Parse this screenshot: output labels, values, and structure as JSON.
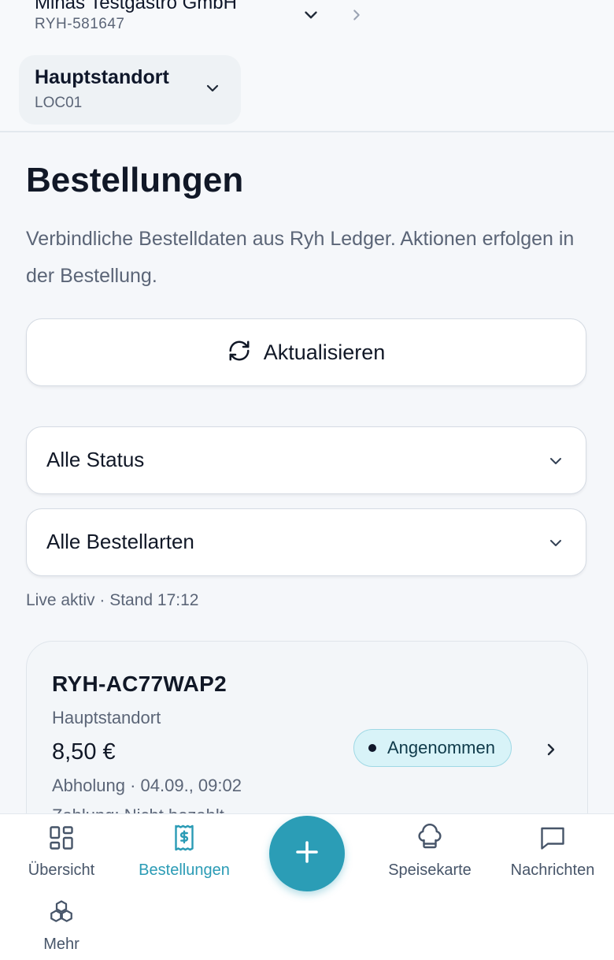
{
  "header": {
    "org_name": "Minas Testgastro GmbH",
    "org_id": "RYH-581647",
    "location_name": "Hauptstandort",
    "location_code": "LOC01"
  },
  "page": {
    "title": "Bestellungen",
    "subtitle": "Verbindliche Bestelldaten aus Ryh Ledger. Aktionen erfolgen in der Bestellung."
  },
  "actions": {
    "refresh_label": "Aktualisieren"
  },
  "filters": {
    "status_selected": "Alle Status",
    "type_selected": "Alle Bestellarten"
  },
  "live_status": "Live aktiv · Stand 17:12",
  "orders": [
    {
      "id": "RYH-AC77WAP2",
      "location": "Hauptstandort",
      "price": "8,50 €",
      "type_time": "Abholung · 04.09., 09:02",
      "payment": "Zahlung: Nicht bezahlt",
      "status": "Angenommen"
    }
  ],
  "bottom_nav": {
    "items": [
      {
        "label": "Übersicht",
        "icon": "grid-icon"
      },
      {
        "label": "Bestellungen",
        "icon": "receipt-icon",
        "active": true
      },
      {
        "label": "Speisekarte",
        "icon": "chef-hat-icon"
      },
      {
        "label": "Nachrichten",
        "icon": "message-icon"
      },
      {
        "label": "Mehr",
        "icon": "boxes-icon"
      }
    ],
    "fab_icon": "plus-icon"
  },
  "colors": {
    "accent": "#2b9db6",
    "badge_bg": "#d8f3f8",
    "text_primary": "#111827",
    "text_muted": "#5b6577"
  }
}
